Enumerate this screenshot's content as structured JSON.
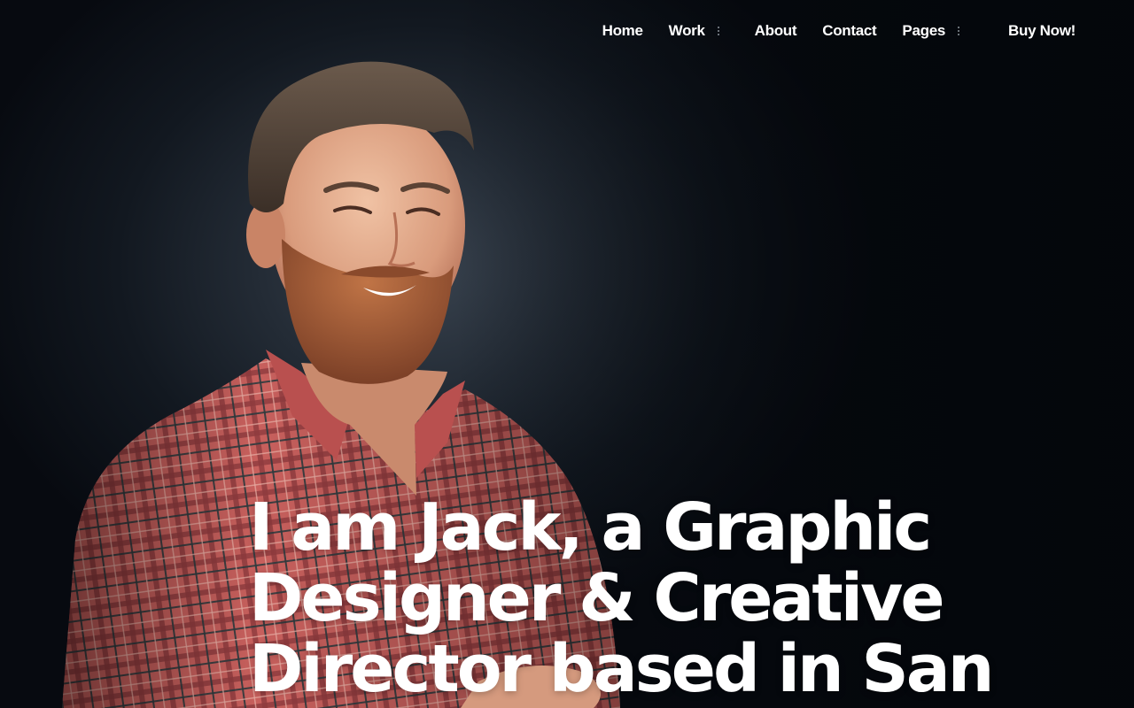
{
  "nav": {
    "items": [
      {
        "label": "Home",
        "has_submenu": false
      },
      {
        "label": "Work",
        "has_submenu": true
      },
      {
        "label": "About",
        "has_submenu": false
      },
      {
        "label": "Contact",
        "has_submenu": false
      },
      {
        "label": "Pages",
        "has_submenu": true
      }
    ],
    "cta_label": "Buy Now!"
  },
  "hero": {
    "headline": "I am Jack, a Graphic Designer & Creative Director based in San"
  },
  "colors": {
    "background": "#05080d",
    "text": "#ffffff",
    "submenu_dots": "#8d949c"
  }
}
